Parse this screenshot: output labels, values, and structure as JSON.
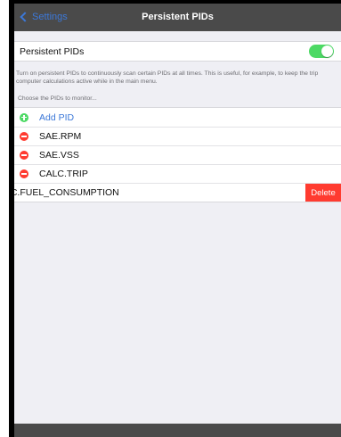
{
  "navbar": {
    "back_label": "Settings",
    "title": "Persistent PIDs"
  },
  "toggle_section": {
    "label": "Persistent PIDs",
    "enabled": true,
    "description": "Turn on persistent PIDs to continuously scan certain PIDs at all times. This is useful, for example, to keep the trip computer calculations active while in the main menu."
  },
  "pid_section": {
    "header": "Choose the PIDs to monitor...",
    "add_label": "Add PID",
    "items": [
      {
        "label": "SAE.RPM"
      },
      {
        "label": "SAE.VSS"
      },
      {
        "label": "CALC.TRIP"
      }
    ],
    "swiped_item": {
      "label": "_C.FUEL_CONSUMPTION",
      "delete_label": "Delete"
    }
  },
  "colors": {
    "accent": "#3c78d8",
    "toggle_on": "#4cd964",
    "destructive": "#ff3b30",
    "navbar": "#4a4a4a"
  }
}
